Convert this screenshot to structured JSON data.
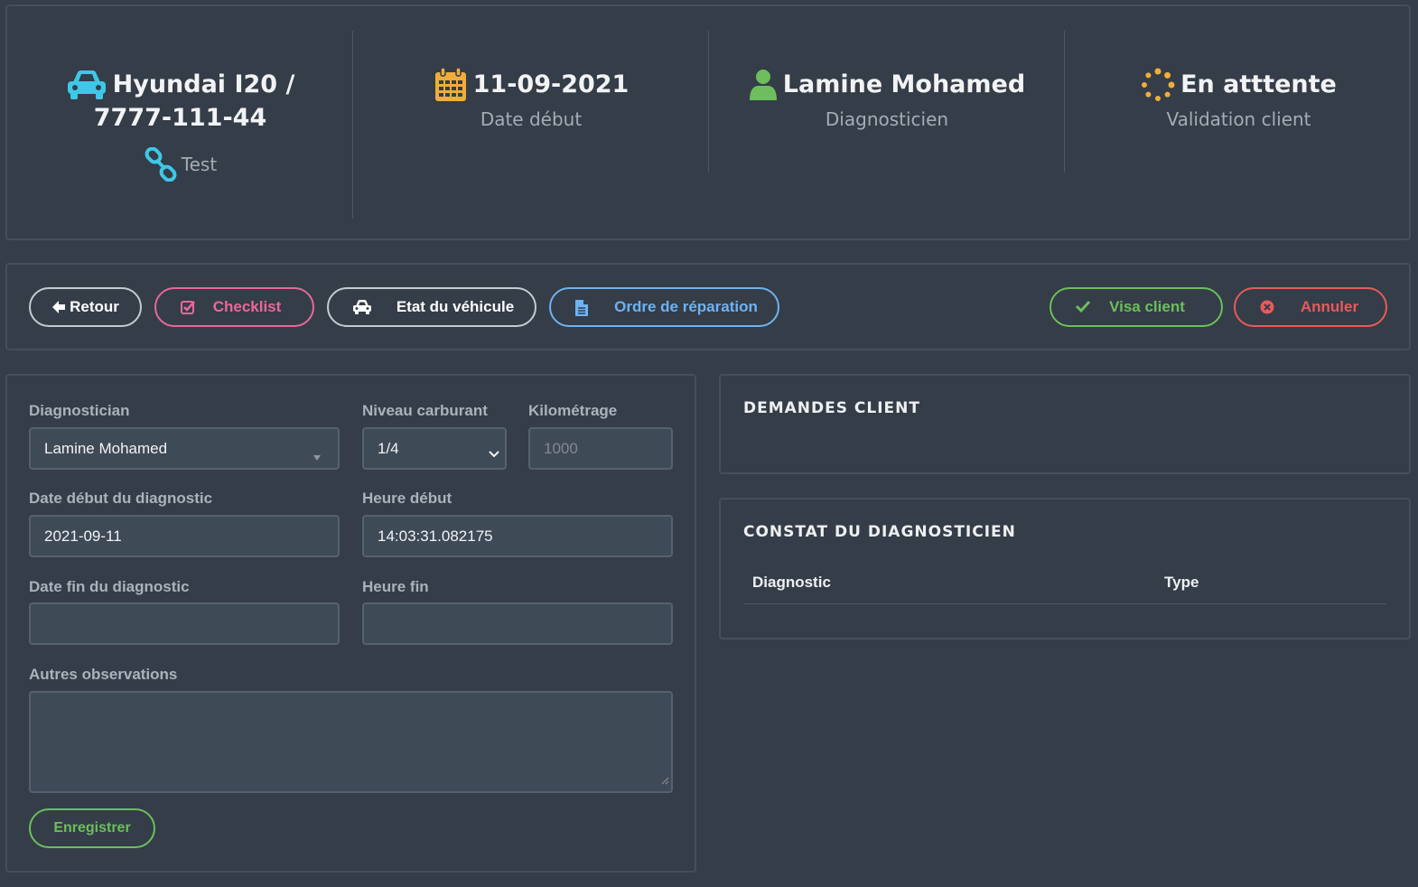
{
  "header": {
    "vehicle": {
      "title": "Hyundai I20 /",
      "plate": "7777-111-44",
      "link_label": "Test",
      "icon": "car-icon",
      "link_icon": "link-icon",
      "icon_color": "#3ec8e8"
    },
    "date": {
      "title": "11-09-2021",
      "subtitle": "Date début",
      "icon": "calendar-icon",
      "icon_color": "#f0ad3c"
    },
    "diagnostician": {
      "title": "Lamine Mohamed",
      "subtitle": "Diagnosticien",
      "icon": "user-icon",
      "icon_color": "#6cbf5c"
    },
    "status": {
      "title": "En atttente",
      "subtitle": "Validation client",
      "icon": "spinner-icon",
      "icon_color": "#f0ad3c"
    }
  },
  "toolbar": {
    "back_label": "Retour",
    "checklist_label": "Checklist",
    "vehicle_state_label": "Etat du véhicule",
    "repair_order_label": "Ordre de réparation",
    "visa_label": "Visa client",
    "cancel_label": "Annuler",
    "colors": {
      "checklist": "#e8689a",
      "repair_order": "#6fb2f2",
      "visa": "#6cbf5c",
      "cancel": "#e85a5a",
      "neutral": "#c4cad1"
    }
  },
  "form": {
    "diagnostician_label": "Diagnostician",
    "diagnostician_value": "Lamine Mohamed",
    "fuel_label": "Niveau carburant",
    "fuel_value": "1/4",
    "mileage_label": "Kilométrage",
    "mileage_placeholder": "1000",
    "start_date_label": "Date début du diagnostic",
    "start_date_value": "2021-09-11",
    "start_time_label": "Heure début",
    "start_time_value": "14:03:31.082175",
    "end_date_label": "Date fin du diagnostic",
    "end_date_value": "",
    "end_time_label": "Heure fin",
    "end_time_value": "",
    "observations_label": "Autres observations",
    "observations_value": "",
    "save_label": "Enregistrer"
  },
  "demandes": {
    "title": "DEMANDES CLIENT"
  },
  "constat": {
    "title": "CONSTAT DU DIAGNOSTICIEN",
    "columns": [
      "Diagnostic",
      "Type"
    ]
  }
}
